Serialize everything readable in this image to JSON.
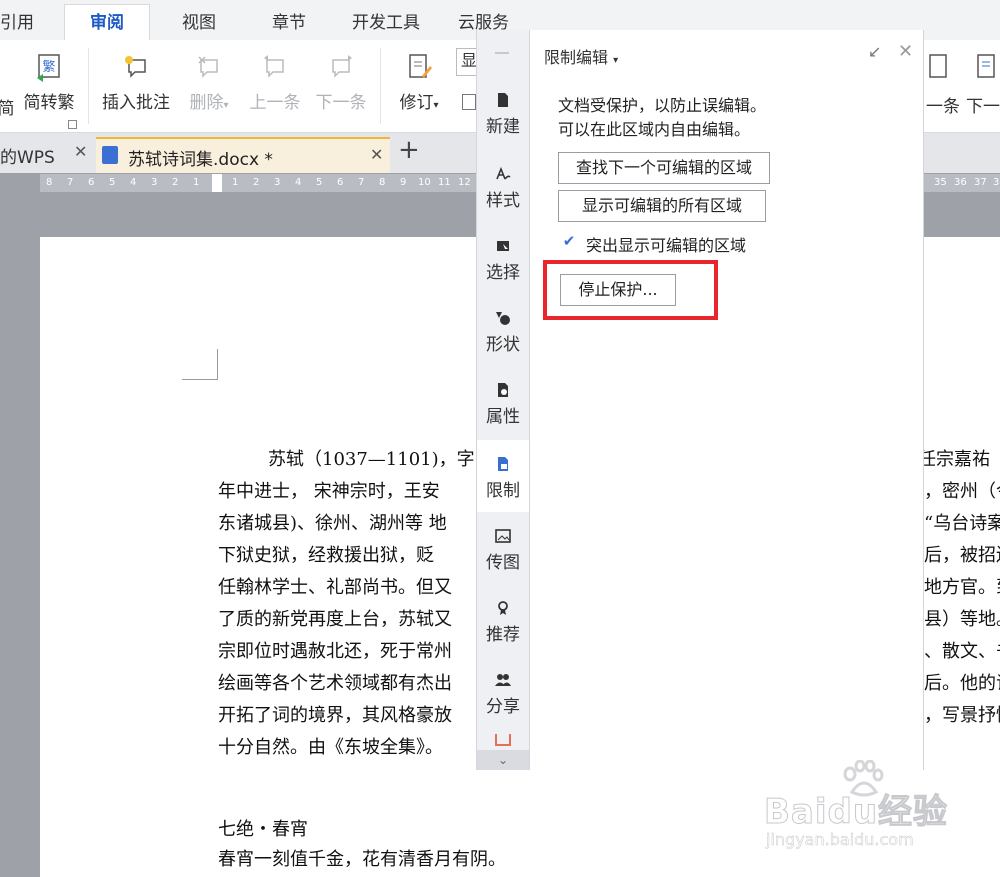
{
  "menu": {
    "tabs": [
      "引用",
      "审阅",
      "视图",
      "章节",
      "开发工具",
      "云服务"
    ],
    "active_tab": "审阅"
  },
  "ribbon": {
    "left_partial": "简",
    "simplified_traditional": "简转繁",
    "simplified_traditional_icon_char": "繁",
    "insert_comment": "插入批注",
    "delete": "删除",
    "previous": "上一条",
    "next": "下一条",
    "revise": "修订",
    "display_partial": "显",
    "right_prev_partial": "一条",
    "right_next_partial": "下一"
  },
  "doc_tabs": {
    "first_partial": "的WPS",
    "active": "苏轼诗词集.docx *",
    "add": "+"
  },
  "ruler": {
    "left_nums": [
      "8",
      "7",
      "6",
      "5",
      "4",
      "3",
      "2",
      "1"
    ],
    "right_nums": [
      "1",
      "2",
      "3",
      "4",
      "5",
      "6",
      "7",
      "8",
      "9",
      "10",
      "11",
      "12"
    ],
    "far_right_nums": [
      "35",
      "36",
      "37",
      "3"
    ]
  },
  "side_panel": {
    "items": [
      "新建",
      "样式",
      "选择",
      "形状",
      "属性",
      "限制",
      "传图",
      "推荐",
      "分享"
    ],
    "active": "限制"
  },
  "restrict_panel": {
    "title": "限制编辑",
    "line1": "文档受保护，以防止误编辑。",
    "line2": "可以在此区域内自由编辑。",
    "find_next": "查找下一个可编辑的区域",
    "show_all": "显示可编辑的所有区域",
    "highlight": "突出显示可编辑的区域",
    "highlight_checked": true,
    "stop": "停止保护..."
  },
  "document": {
    "para_lines": [
      "苏轼（1037—1101)，字",
      "年中进士，  宋神宗时，王安",
      "东诸城县)、徐州、湖州等 地",
      "下狱史狱，经救援出狱，贬",
      "任翰林学士、礼部尚书。但又",
      "了质的新党再度上台，苏轼又",
      "宗即位时遇赦北还，死于常州",
      "绘画等各个艺术领域都有杰出",
      "开拓了词的境界，其风格豪放",
      "十分自然。由《东坡全集》。"
    ],
    "right_fragments": [
      "宋任宗嘉祐",
      "，密州（今山",
      "“乌台诗案”",
      "后，被招还",
      "地方官。到",
      "县）等地。",
      "、散文、书法",
      "后。他的词",
      "，写景抒情"
    ],
    "poem_title": "七绝・春宵",
    "poem_line": "春宵一刻值千金，花有清香月有阴。"
  },
  "watermark": {
    "brand": "Baidu经验",
    "url": "jingyan.baidu.com"
  },
  "colors": {
    "accent": "#1e5bc6",
    "highlight_box": "#e8262b",
    "doc_tab": "#f8f0dc"
  }
}
